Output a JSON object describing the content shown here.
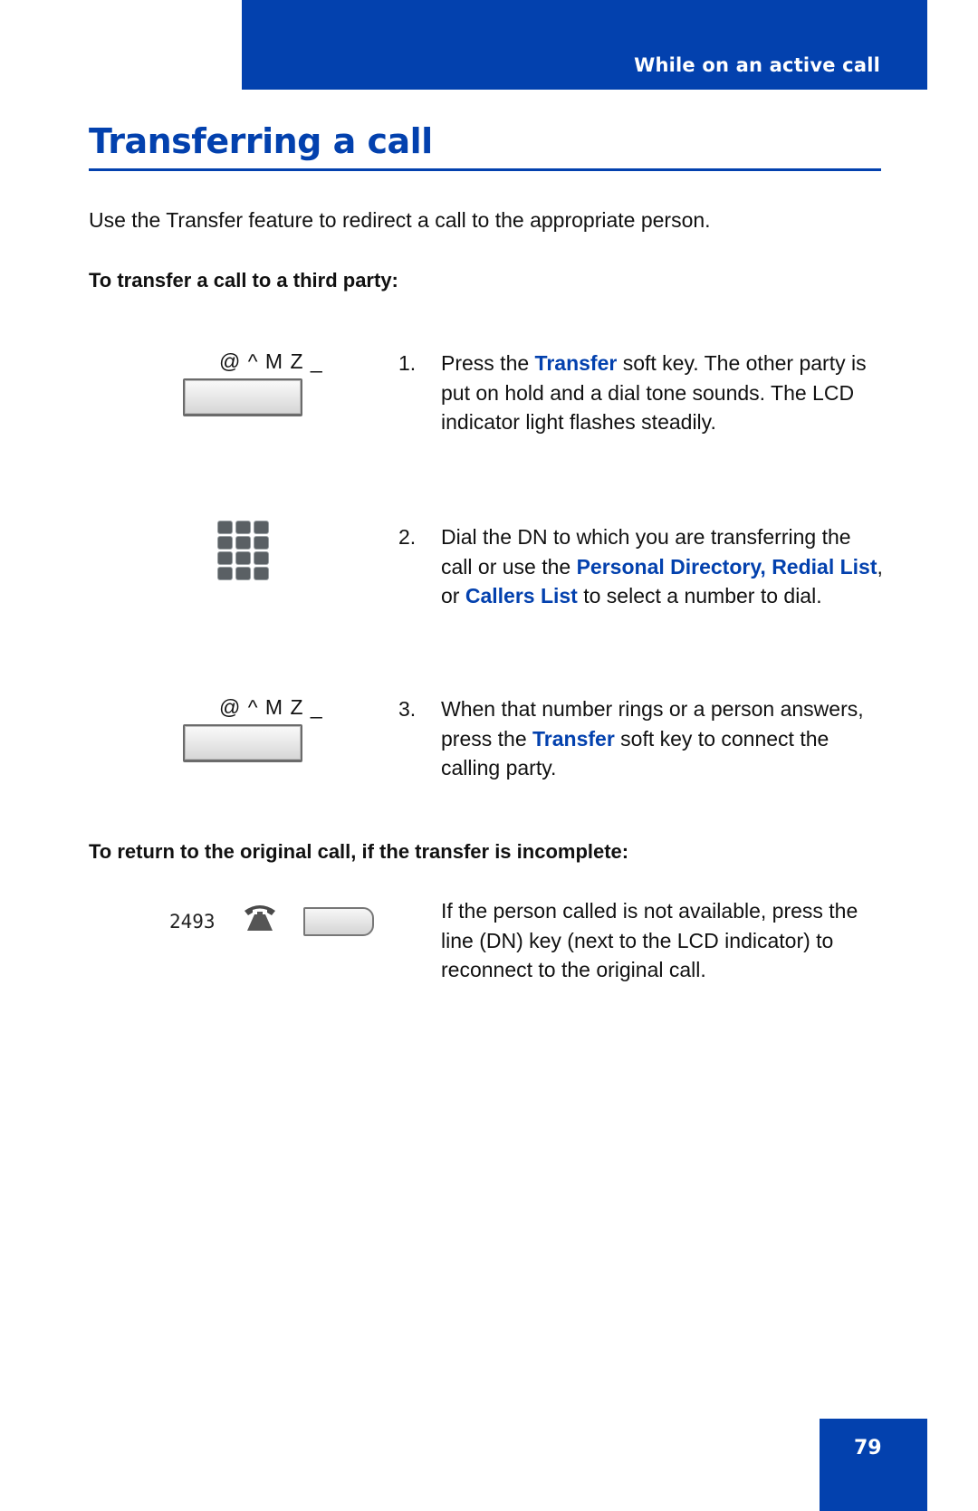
{
  "header": {
    "section_title": "While on an active call"
  },
  "page": {
    "title": "Transferring a call",
    "intro": "Use the Transfer feature to redirect a call to the appropriate person.",
    "subheading_transfer": "To transfer a call to a third party:",
    "softkey_label": "@ ^ M Z _",
    "steps": [
      {
        "number": "1.",
        "parts": [
          {
            "text": "Press the ",
            "highlight": false
          },
          {
            "text": "Transfer",
            "highlight": true
          },
          {
            "text": " soft key. The other party is put on hold and a dial tone sounds. The LCD indicator light flashes steadily.",
            "highlight": false
          }
        ]
      },
      {
        "number": "2.",
        "parts": [
          {
            "text": "Dial the DN to which you are transferring the call or use the ",
            "highlight": false
          },
          {
            "text": "Personal Directory, Redial List",
            "highlight": true
          },
          {
            "text": ", or ",
            "highlight": false
          },
          {
            "text": "Callers List",
            "highlight": true
          },
          {
            "text": " to select a number to dial.",
            "highlight": false
          }
        ]
      },
      {
        "number": "3.",
        "parts": [
          {
            "text": "When that number rings or a person answers, press the ",
            "highlight": false
          },
          {
            "text": "Transfer",
            "highlight": true
          },
          {
            "text": " soft key to connect the calling party.",
            "highlight": false
          }
        ]
      }
    ],
    "subheading_return": "To return to the original call, if the transfer is incomplete:",
    "dn_number": "2493",
    "return_text": "If the person called is not available, press the line (DN) key (next to the LCD indicator) to reconnect to the original call.",
    "page_number": "79"
  },
  "icons": {
    "softkey": "softkey-button-icon",
    "keypad": "dialpad-icon",
    "phone": "telephone-icon",
    "line_key": "line-key-icon"
  },
  "colors": {
    "brand_blue": "#0341ae"
  }
}
